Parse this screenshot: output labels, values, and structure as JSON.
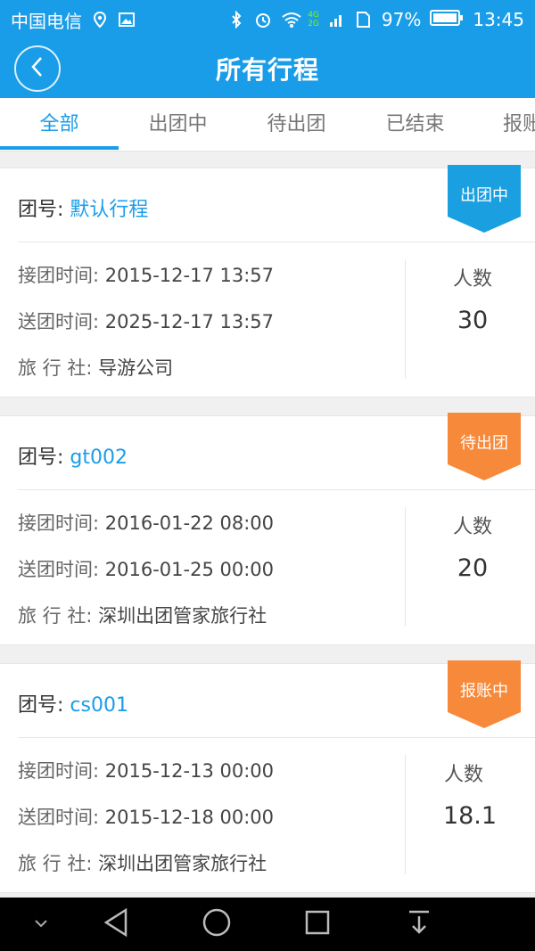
{
  "status_bar": {
    "carrier": "中国电信",
    "net_4g": "4G",
    "net_2g": "2G",
    "battery": "97%",
    "time": "13:45"
  },
  "header": {
    "title": "所有行程"
  },
  "tabs": [
    {
      "label": "全部"
    },
    {
      "label": "出团中"
    },
    {
      "label": "待出团"
    },
    {
      "label": "已结束"
    },
    {
      "label": "报账"
    }
  ],
  "trips": [
    {
      "tuan_label": "团号: ",
      "tuan_no": "默认行程",
      "status": "出团中",
      "status_color": "#1aa0e0",
      "pickup_label": "接团时间: ",
      "pickup_time": "2015-12-17  13:57",
      "drop_label": "送团时间: ",
      "drop_time": "2025-12-17  13:57",
      "agency_label": "旅 行 社: ",
      "agency": "导游公司",
      "count_label": "人数",
      "count": "30"
    },
    {
      "tuan_label": "团号: ",
      "tuan_no": "gt002",
      "status": "待出团",
      "status_color": "#f7893a",
      "pickup_label": "接团时间: ",
      "pickup_time": "2016-01-22  08:00",
      "drop_label": "送团时间: ",
      "drop_time": "2016-01-25  00:00",
      "agency_label": "旅 行 社: ",
      "agency": "深圳出团管家旅行社",
      "count_label": "人数",
      "count": "20"
    },
    {
      "tuan_label": "团号: ",
      "tuan_no": "cs001",
      "status": "报账中",
      "status_color": "#f7893a",
      "pickup_label": "接团时间: ",
      "pickup_time": "2015-12-13  00:00",
      "drop_label": "送团时间: ",
      "drop_time": "2015-12-18  00:00",
      "agency_label": "旅 行 社: ",
      "agency": "深圳出团管家旅行社",
      "count_label": "人数",
      "count": "18.1"
    }
  ],
  "colors": {
    "brand": "#1a9de8",
    "orange": "#f7893a"
  }
}
